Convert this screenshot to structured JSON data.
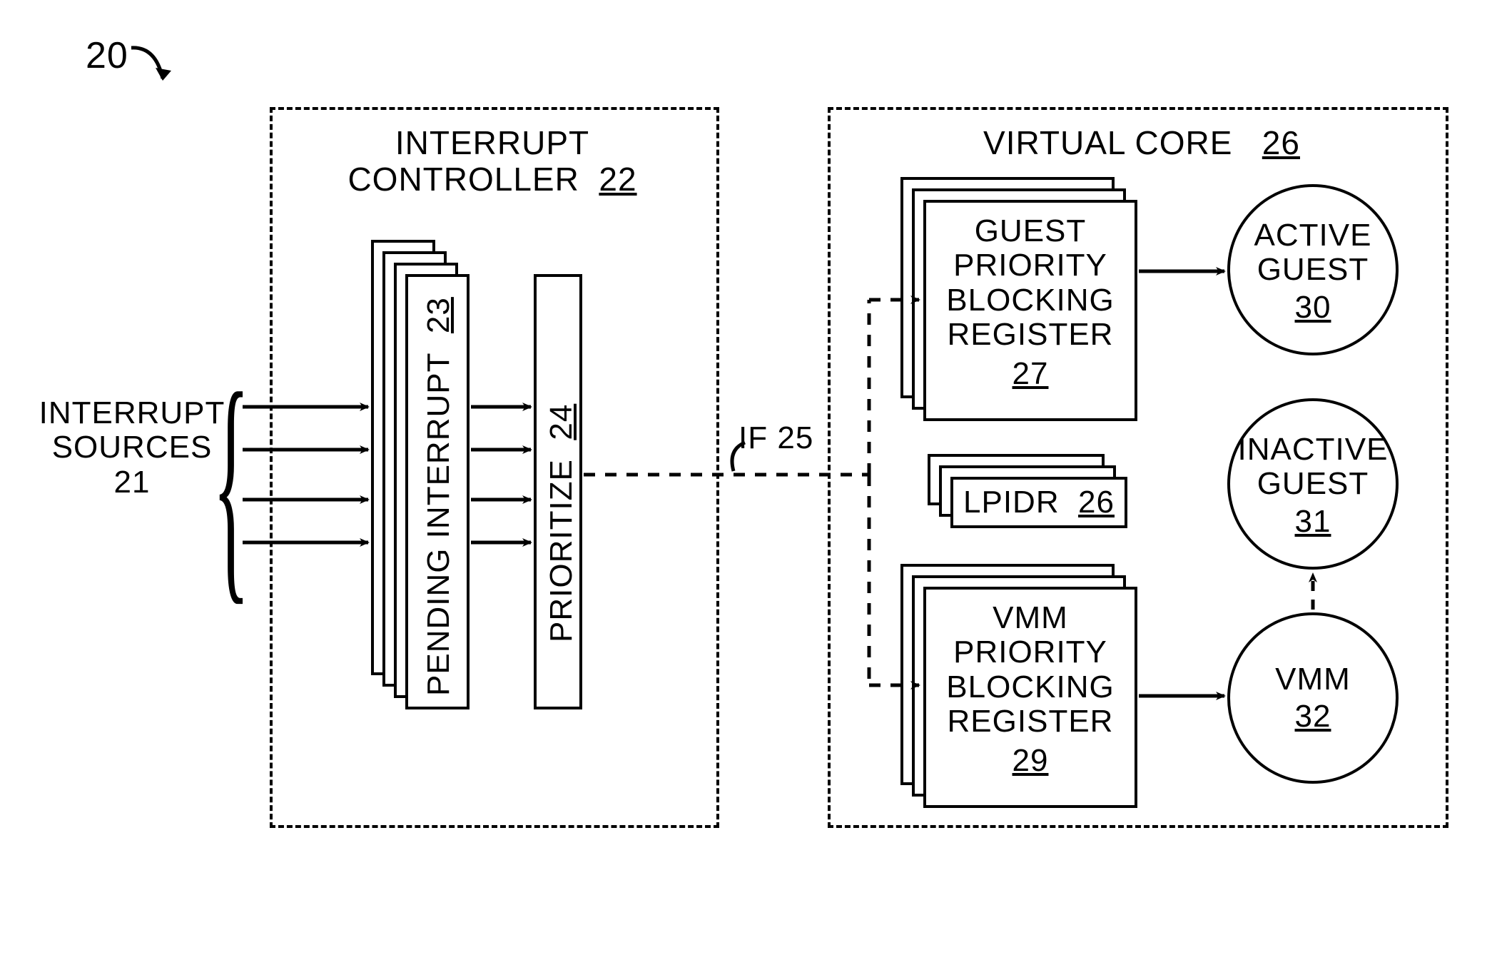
{
  "figure_ref": {
    "num": "20"
  },
  "interrupt_sources": {
    "label_top": "INTERRUPT",
    "label_mid": "SOURCES",
    "num": "21"
  },
  "interrupt_controller": {
    "title": "INTERRUPT CONTROLLER",
    "num": "22",
    "pending": {
      "label": "PENDING INTERRUPT",
      "num": "23"
    },
    "prioritize": {
      "label": "PRIORITIZE",
      "num": "24"
    }
  },
  "interface": {
    "label": "IF",
    "num": "25"
  },
  "virtual_core": {
    "title": "VIRTUAL CORE",
    "num": "26",
    "gpbr": {
      "l1": "GUEST",
      "l2": "PRIORITY",
      "l3": "BLOCKING",
      "l4": "REGISTER",
      "num": "27"
    },
    "lpidr": {
      "label": "LPIDR",
      "num": "26"
    },
    "vpbr": {
      "l1": "VMM",
      "l2": "PRIORITY",
      "l3": "BLOCKING",
      "l4": "REGISTER",
      "num": "29"
    },
    "active_guest": {
      "l1": "ACTIVE",
      "l2": "GUEST",
      "num": "30"
    },
    "inactive_guest": {
      "l1": "INACTIVE",
      "l2": "GUEST",
      "num": "31"
    },
    "vmm": {
      "label": "VMM",
      "num": "32"
    }
  }
}
